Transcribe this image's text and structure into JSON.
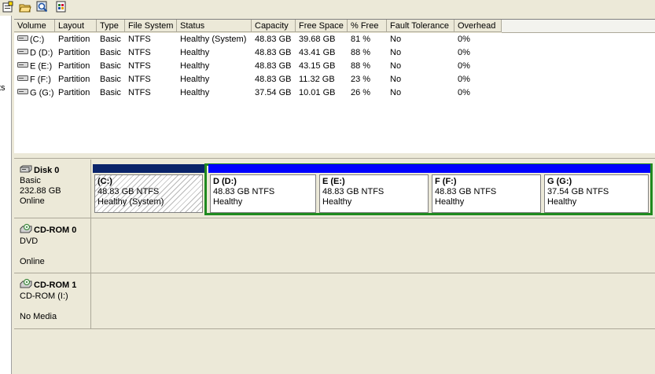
{
  "toolbar": {
    "icons": [
      "properties-icon",
      "open-icon",
      "find-icon",
      "refresh-icon"
    ]
  },
  "left_pane": {
    "fragment": "ts"
  },
  "volume_list": {
    "columns": [
      "Volume",
      "Layout",
      "Type",
      "File System",
      "Status",
      "Capacity",
      "Free Space",
      "% Free",
      "Fault Tolerance",
      "Overhead"
    ],
    "rows": [
      [
        "(C:)",
        "Partition",
        "Basic",
        "NTFS",
        "Healthy (System)",
        "48.83 GB",
        "39.68 GB",
        "81 %",
        "No",
        "0%"
      ],
      [
        "D (D:)",
        "Partition",
        "Basic",
        "NTFS",
        "Healthy",
        "48.83 GB",
        "43.41 GB",
        "88 %",
        "No",
        "0%"
      ],
      [
        "E (E:)",
        "Partition",
        "Basic",
        "NTFS",
        "Healthy",
        "48.83 GB",
        "43.15 GB",
        "88 %",
        "No",
        "0%"
      ],
      [
        "F (F:)",
        "Partition",
        "Basic",
        "NTFS",
        "Healthy",
        "48.83 GB",
        "11.32 GB",
        "23 %",
        "No",
        "0%"
      ],
      [
        "G (G:)",
        "Partition",
        "Basic",
        "NTFS",
        "Healthy",
        "37.54 GB",
        "10.01 GB",
        "26 %",
        "No",
        "0%"
      ]
    ]
  },
  "disks": [
    {
      "name": "Disk 0",
      "lines": [
        "Basic",
        "232.88 GB",
        "Online"
      ],
      "partitions": [
        {
          "title": "(C:)",
          "size": "48.83 GB NTFS",
          "status": "Healthy (System)",
          "bar_color": "#0a246a"
        },
        {
          "title": "D  (D:)",
          "size": "48.83 GB NTFS",
          "status": "Healthy",
          "bar_color": "#0000ff"
        },
        {
          "title": "E  (E:)",
          "size": "48.83 GB NTFS",
          "status": "Healthy",
          "bar_color": "#0000ff"
        },
        {
          "title": "F  (F:)",
          "size": "48.83 GB NTFS",
          "status": "Healthy",
          "bar_color": "#0000ff"
        },
        {
          "title": "G  (G:)",
          "size": "37.54 GB NTFS",
          "status": "Healthy",
          "bar_color": "#0000ff"
        }
      ]
    },
    {
      "name": "CD-ROM 0",
      "lines": [
        "DVD",
        "",
        "Online"
      ]
    },
    {
      "name": "CD-ROM 1",
      "lines": [
        "CD-ROM (I:)",
        "",
        "No Media"
      ]
    }
  ],
  "colors": {
    "extended_border": "#1f8a1f",
    "primary_bar": "#0a246a",
    "logical_bar": "#0000ff"
  }
}
